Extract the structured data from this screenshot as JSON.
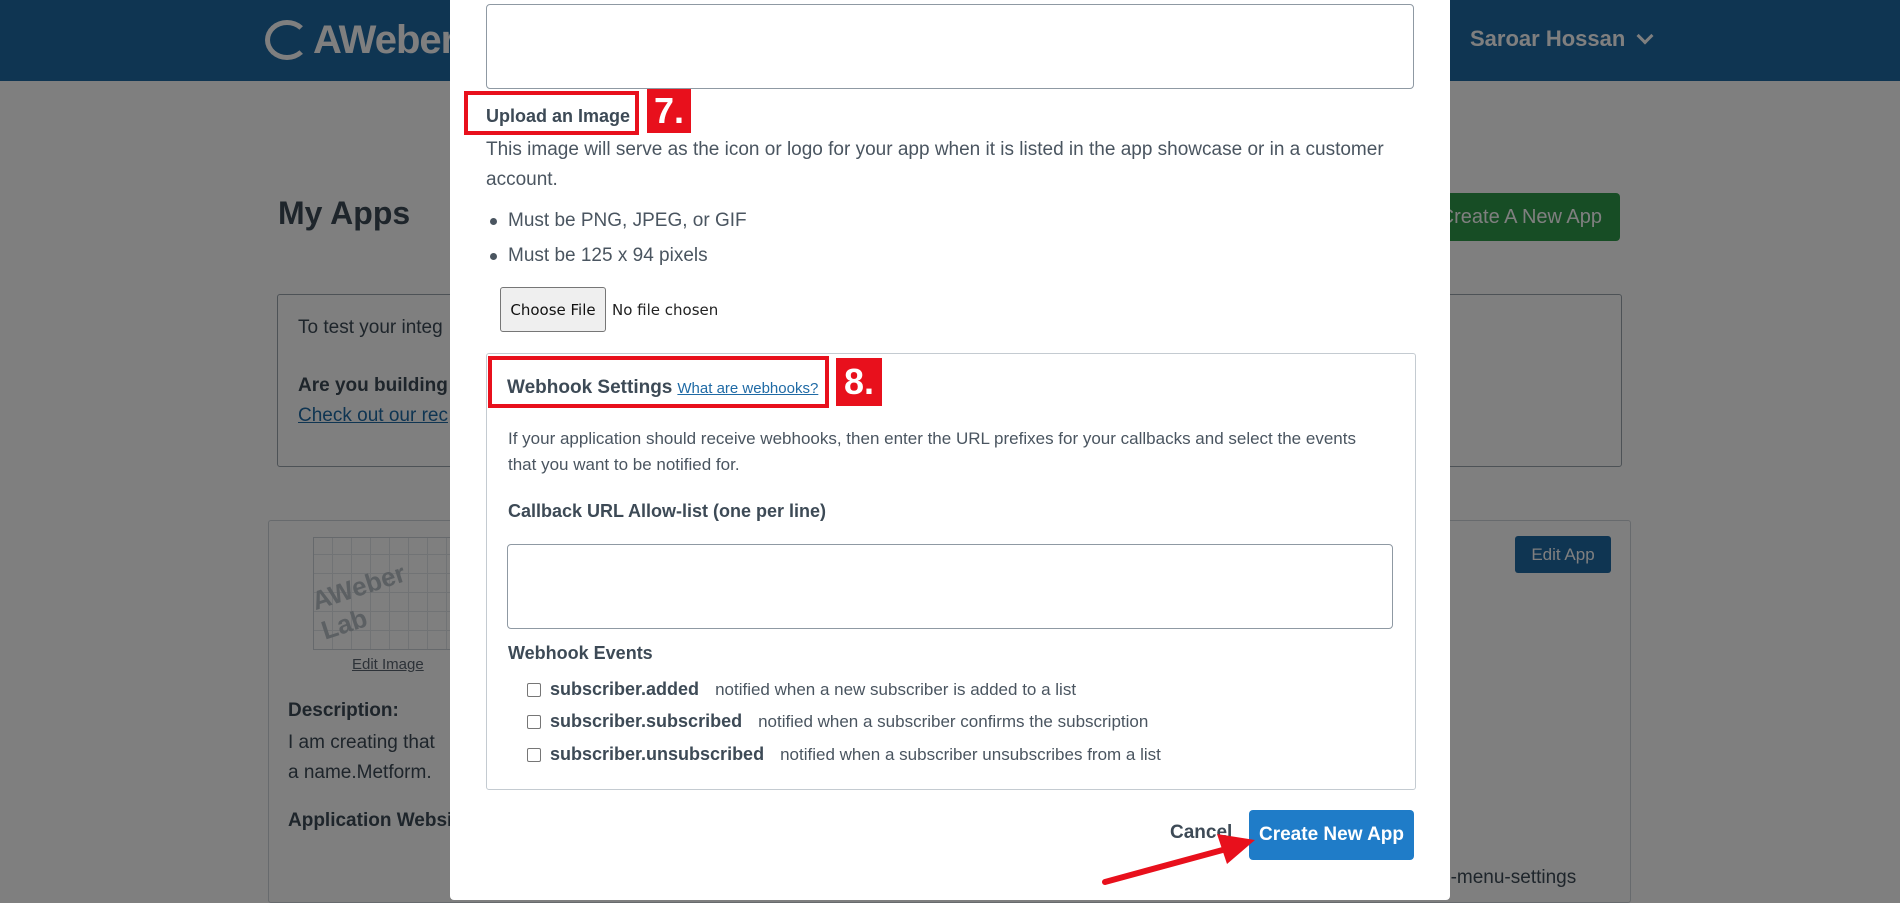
{
  "header": {
    "logo_text": "AWeber",
    "user_name": "Saroar Hossan"
  },
  "background": {
    "page_title": "My Apps",
    "create_app_button": "Create A New App",
    "info_line1": "To test your integ",
    "info_line2": "Are you building",
    "info_link": "Check out our rec",
    "thumb_text": "AWeber Lab",
    "edit_image": "Edit Image",
    "edit_app": "Edit App",
    "description_label": "Description:",
    "description_text": "I am creating that a name.Metform.",
    "website_label": "Application Websi",
    "menu_settings_text": "n-menu-settings"
  },
  "modal": {
    "upload": {
      "label": "Upload an Image",
      "description": "This image will serve as the icon or logo for your app when it is listed in the app showcase or in a customer account.",
      "requirements": [
        "Must be PNG, JPEG, or GIF",
        "Must be 125 x 94 pixels"
      ],
      "choose_file_button": "Choose File",
      "no_file_text": "No file chosen"
    },
    "webhook": {
      "title": "Webhook Settings",
      "help_link": "What are webhooks?",
      "description": "If your application should receive webhooks, then enter the URL prefixes for your callbacks and select the events that you want to be notified for.",
      "callback_label": "Callback URL Allow-list (one per line)",
      "events_label": "Webhook Events",
      "events": [
        {
          "name": "subscriber.added",
          "description": "notified when a new subscriber is added to a list",
          "checked": false
        },
        {
          "name": "subscriber.subscribed",
          "description": "notified when a subscriber confirms the subscription",
          "checked": false
        },
        {
          "name": "subscriber.unsubscribed",
          "description": "notified when a subscriber unsubscribes from a list",
          "checked": false
        }
      ]
    },
    "cancel_label": "Cancel",
    "create_label": "Create New App"
  },
  "annotations": {
    "step7": "7.",
    "step8": "8.",
    "highlight_color": "#e8101c"
  }
}
